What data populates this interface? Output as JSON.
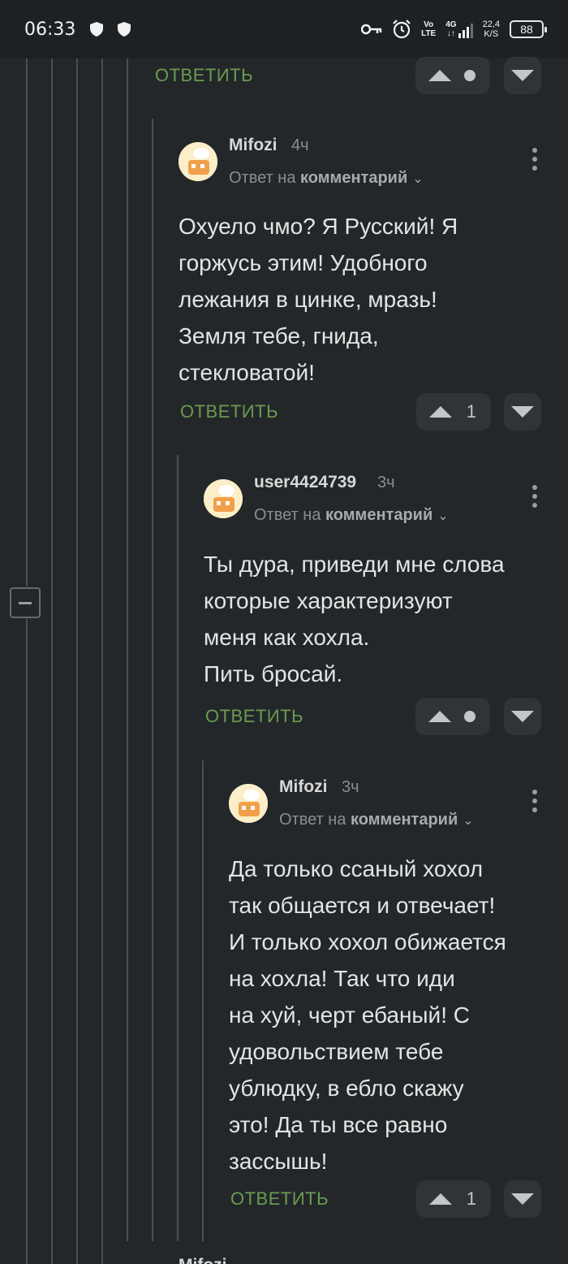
{
  "status_bar": {
    "time": "06:33",
    "network_vo": "Vo",
    "network_lte": "LTE",
    "network_4g": "4G",
    "speed_value": "22,4",
    "speed_unit": "K/S",
    "battery": "88"
  },
  "labels": {
    "reply": "ОТВЕТИТЬ",
    "reply_to_prefix": "Ответ на",
    "reply_to_target": "комментарий"
  },
  "top_actions": {
    "vote_count": ""
  },
  "comments": [
    {
      "username": "Mifozi",
      "time": "4ч",
      "text": "Охуело чмо? Я Русский! Я\nгоржусь этим! Удобного\nлежания в цинке, мразь!\nЗемля тебе, гнида,\nстекловатой!",
      "vote_count": "1"
    },
    {
      "username": "user4424739",
      "time": "3ч",
      "text": "Ты дура, приведи мне слова\nкоторые характеризуют\nменя как хохла.\nПить бросай.",
      "vote_count": ""
    },
    {
      "username": "Mifozi",
      "time": "3ч",
      "text": "Да только ссаный хохол\nтак общается и отвечает!\nИ только хохол обижается\nна хохла! Так что иди\nна хуй, черт ебаный! С\nудовольствием тебе\nублюдку, в ебло скажу\nэто! Да ты все равно\nзассышь!",
      "vote_count": "1"
    }
  ],
  "partial_next": {
    "username": "Mifozi"
  },
  "colors": {
    "background": "#23272a",
    "reply_green": "#6b9b50",
    "thread_line": "#4a4f54"
  }
}
